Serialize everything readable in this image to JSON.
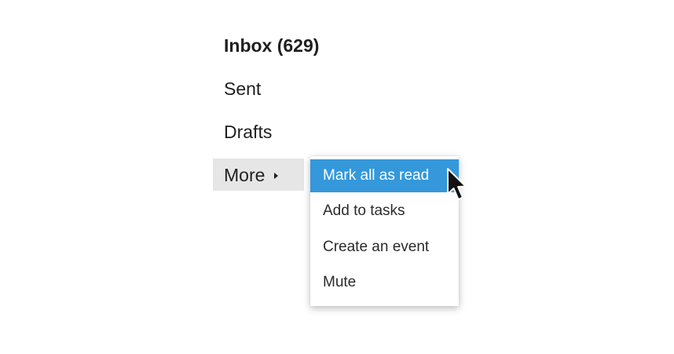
{
  "nav": {
    "items": [
      {
        "label": "Inbox (629)"
      },
      {
        "label": "Sent"
      },
      {
        "label": "Drafts"
      },
      {
        "label": "More"
      }
    ]
  },
  "context_menu": {
    "items": [
      {
        "label": "Mark all as read",
        "highlighted": true
      },
      {
        "label": "Add to tasks"
      },
      {
        "label": "Create an event"
      },
      {
        "label": "Mute"
      }
    ],
    "highlight_color": "#3498db"
  },
  "icons": {
    "more_arrow": "caret-right-icon",
    "cursor": "mouse-pointer-icon"
  }
}
